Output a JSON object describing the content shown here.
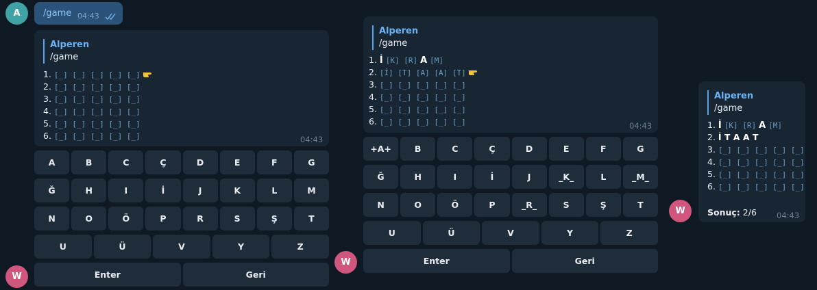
{
  "avatars": {
    "sender": "A",
    "bot": "W"
  },
  "sent": {
    "text": "/game",
    "time": "04:43"
  },
  "reply": {
    "name": "Alperen",
    "text": "/game"
  },
  "msg1": {
    "time": "04:43",
    "lines": [
      {
        "num": "1.",
        "cells": "[_] [_] [_] [_] [_]"
      },
      {
        "num": "2.",
        "cells": "[_] [_] [_] [_] [_]"
      },
      {
        "num": "3.",
        "cells": "[_] [_] [_] [_] [_]"
      },
      {
        "num": "4.",
        "cells": "[_] [_] [_] [_] [_]"
      },
      {
        "num": "5.",
        "cells": "[_] [_] [_] [_] [_]"
      },
      {
        "num": "6.",
        "cells": "[_] [_] [_] [_] [_]"
      }
    ]
  },
  "msg2": {
    "time": "04:43",
    "line1": {
      "num": "1.",
      "a": "İ",
      "b": "[K] [R]",
      "c": "A",
      "d": "[M]"
    },
    "line2": {
      "num": "2.",
      "cells": "[İ] [T] [A] [A] [T]"
    },
    "rest": [
      {
        "num": "3.",
        "cells": "[_] [_] [_] [_] [_]"
      },
      {
        "num": "4.",
        "cells": "[_] [_] [_] [_] [_]"
      },
      {
        "num": "5.",
        "cells": "[_] [_] [_] [_] [_]"
      },
      {
        "num": "6.",
        "cells": "[_] [_] [_] [_] [_]"
      }
    ]
  },
  "msg3": {
    "time": "04:43",
    "line1": {
      "num": "1.",
      "a": "İ",
      "b": "[K] [R]",
      "c": "A",
      "d": "[M]"
    },
    "line2": {
      "num": "2.",
      "word": "İ T A A T"
    },
    "rest": [
      {
        "num": "3.",
        "cells": "[_] [_] [_] [_] [_]"
      },
      {
        "num": "4.",
        "cells": "[_] [_] [_] [_] [_]"
      },
      {
        "num": "5.",
        "cells": "[_] [_] [_] [_] [_]"
      },
      {
        "num": "6.",
        "cells": "[_] [_] [_] [_] [_]"
      }
    ],
    "result_label": "Sonuç:",
    "result_value": "2/6"
  },
  "keyboard1": {
    "rows": [
      [
        "A",
        "B",
        "C",
        "Ç",
        "D",
        "E",
        "F",
        "G"
      ],
      [
        "Ğ",
        "H",
        "I",
        "İ",
        "J",
        "K",
        "L",
        "M"
      ],
      [
        "N",
        "O",
        "Ö",
        "P",
        "R",
        "S",
        "Ş",
        "T"
      ],
      [
        "U",
        "Ü",
        "V",
        "Y",
        "Z"
      ],
      [
        "Enter",
        "Geri"
      ]
    ]
  },
  "keyboard2": {
    "rows": [
      [
        "+A+",
        "B",
        "C",
        "Ç",
        "D",
        "E",
        "F",
        "G"
      ],
      [
        "Ğ",
        "H",
        "I",
        "İ",
        "J",
        "_K_",
        "L",
        "_M_"
      ],
      [
        "N",
        "O",
        "Ö",
        "P",
        "_R_",
        "S",
        "Ş",
        "T"
      ],
      [
        "U",
        "Ü",
        "V",
        "Y",
        "Z"
      ],
      [
        "Enter",
        "Geri"
      ]
    ]
  },
  "colors": {
    "bubble": "#182533",
    "sent": "#2b5278",
    "accent": "#6ab2f2",
    "key": "#1f2d3b"
  }
}
